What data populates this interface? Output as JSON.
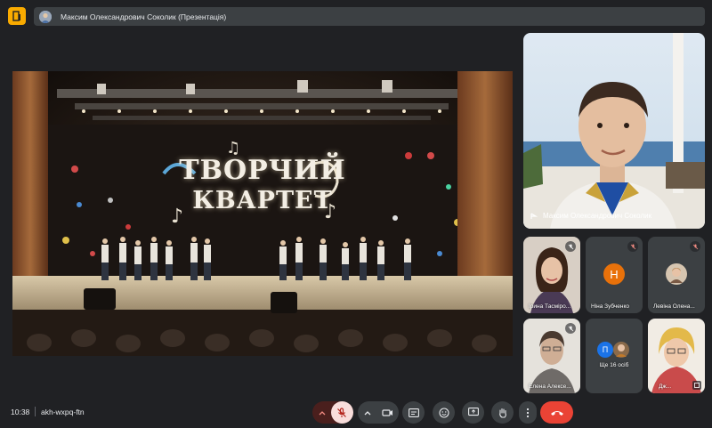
{
  "topbar": {
    "presentation_title": "Максим Олександрович Соколик (Презентація)"
  },
  "stage": {
    "title_line1": "ТВОРЧИЙ",
    "title_line2": "КВАРТЕТ"
  },
  "speaker": {
    "name": "Максим Олександрович Соколик"
  },
  "participants": [
    {
      "name": "Ірина Тасміро...",
      "muted": true
    },
    {
      "name": "Ніна Зубченко",
      "initial": "Н",
      "muted": true
    },
    {
      "name": "Левіна Олена...",
      "muted": true
    },
    {
      "name": "Елена Алексе...",
      "muted": true
    },
    {
      "name": "Ще 16 осіб",
      "initial": "П"
    },
    {
      "name": "Дж..."
    }
  ],
  "bottombar": {
    "time": "10:38",
    "meeting_code": "akh-wxpq-ftn"
  },
  "colors": {
    "background": "#202124",
    "accent_yellow": "#f9ab00",
    "end_call_red": "#ea4335",
    "muted_red": "#f28b82",
    "orange_avatar": "#e8710a"
  }
}
